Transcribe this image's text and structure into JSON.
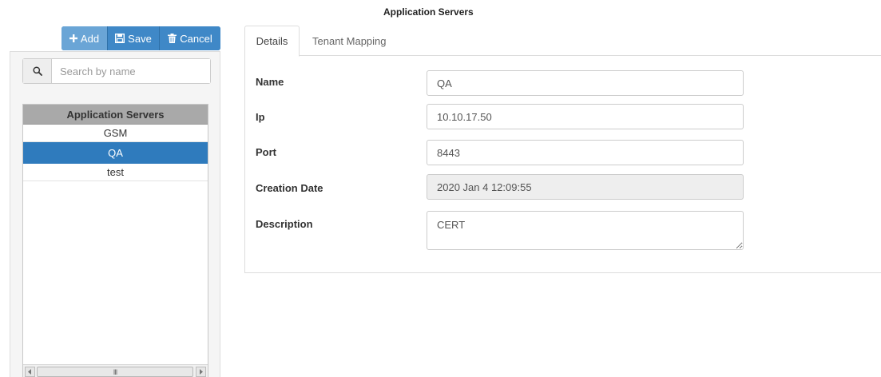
{
  "page": {
    "title": "Application Servers"
  },
  "toolbar": {
    "add_label": "Add",
    "save_label": "Save",
    "cancel_label": "Cancel"
  },
  "search": {
    "placeholder": "Search by name",
    "value": ""
  },
  "server_list": {
    "header": "Application Servers",
    "items": [
      {
        "label": "GSM",
        "selected": false
      },
      {
        "label": "QA",
        "selected": true
      },
      {
        "label": "test",
        "selected": false
      }
    ],
    "scroll_thumb_glyph": "III"
  },
  "tabs": [
    {
      "label": "Details",
      "active": true
    },
    {
      "label": "Tenant Mapping",
      "active": false
    }
  ],
  "form": {
    "name": {
      "label": "Name",
      "value": "QA"
    },
    "ip": {
      "label": "Ip",
      "value": "10.10.17.50"
    },
    "port": {
      "label": "Port",
      "value": "8443"
    },
    "creation_date": {
      "label": "Creation Date",
      "value": "2020 Jan 4 12:09:55"
    },
    "description": {
      "label": "Description",
      "value": "CERT"
    }
  },
  "colors": {
    "primary": "#3f88c7",
    "add_button": "#6aa5d6",
    "selected_row": "#2f7bbd",
    "list_header": "#a9a9a9"
  },
  "icons": {
    "add": "plus-icon",
    "save": "floppy-disk-icon",
    "cancel": "trash-icon",
    "search": "search-icon"
  }
}
